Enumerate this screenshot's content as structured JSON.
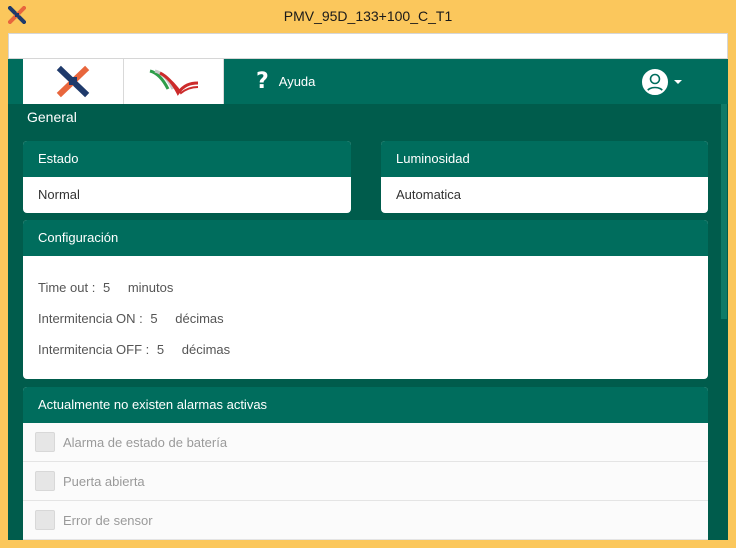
{
  "window": {
    "title": "PMV_95D_133+100_C_T1",
    "url": ""
  },
  "navbar": {
    "help_label": "Ayuda",
    "help_icon": "question-mark-icon",
    "user_icon": "user-avatar-icon"
  },
  "section_title": "General",
  "estado": {
    "title": "Estado",
    "value": "Normal"
  },
  "luminosidad": {
    "title": "Luminosidad",
    "value": "Automatica"
  },
  "configuracion": {
    "title": "Configuración",
    "rows": [
      {
        "label": "Time out :",
        "value": "5",
        "unit": "minutos"
      },
      {
        "label": "Intermitencia ON :",
        "value": "5",
        "unit": "décimas"
      },
      {
        "label": "Intermitencia OFF :",
        "value": "5",
        "unit": "décimas"
      }
    ]
  },
  "alarmas": {
    "title": "Actualmente no existen alarmas activas",
    "items": [
      {
        "label": "Alarma de estado de batería",
        "checked": false
      },
      {
        "label": "Puerta abierta",
        "checked": false
      },
      {
        "label": "Error de sensor",
        "checked": false
      }
    ]
  },
  "colors": {
    "frame": "#fbc75c",
    "primary": "#006d5d",
    "primary_dark": "#005c4c"
  }
}
